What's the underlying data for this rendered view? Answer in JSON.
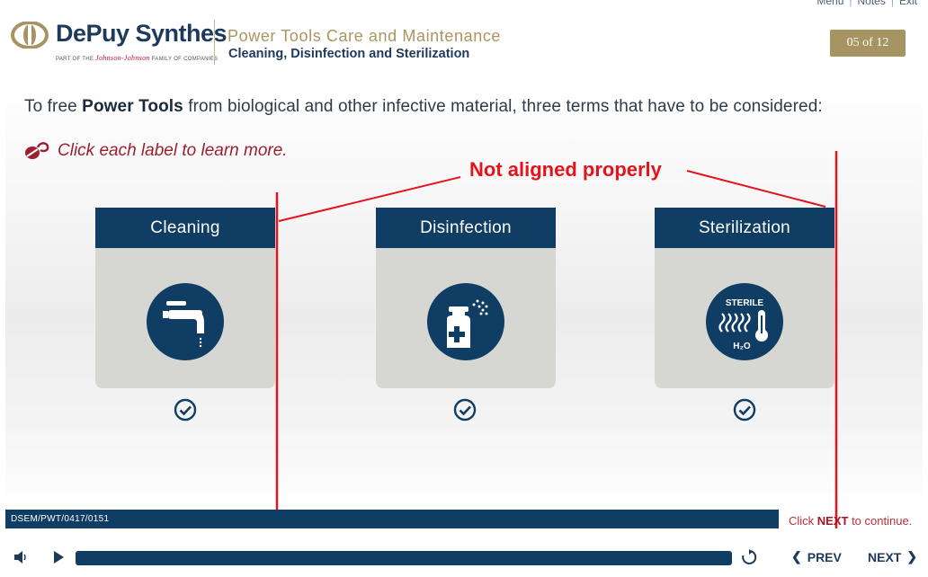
{
  "top_links": {
    "menu": "Menu",
    "notes": "Notes",
    "exit": "Exit"
  },
  "brand": {
    "name": "DePuy Synthes",
    "tag_prefix": "PART OF THE",
    "tag_jj": "Johnson-Johnson",
    "tag_suffix": "FAMILY OF COMPANIES"
  },
  "course": {
    "title": "Power Tools Care and Maintenance",
    "subtitle": "Cleaning, Disinfection and Sterilization"
  },
  "page_indicator": "05 of 12",
  "intro": {
    "prefix": "To free ",
    "bold": "Power Tools",
    "suffix": " from biological and other infective material, three terms that have to be considered:"
  },
  "hint": "Click each label to learn more.",
  "annotation": "Not aligned properly",
  "cards": [
    {
      "label": "Cleaning",
      "icon": "faucet-icon"
    },
    {
      "label": "Disinfection",
      "icon": "disinfectant-spray-icon"
    },
    {
      "label": "Sterilization",
      "icon": "sterile-h2o-icon",
      "icon_text_top": "STERILE",
      "icon_text_bottom": "H₂O"
    }
  ],
  "doc_code": "DSEM/PWT/0417/0151",
  "continue": {
    "prefix": "Click ",
    "bold": "NEXT",
    "suffix": " to continue."
  },
  "nav": {
    "prev": "PREV",
    "next": "NEXT"
  },
  "colors": {
    "navy": "#0f3d64",
    "gold": "#a79463",
    "annotation_red": "#e3141b",
    "card_gray": "#d6d6d3"
  }
}
